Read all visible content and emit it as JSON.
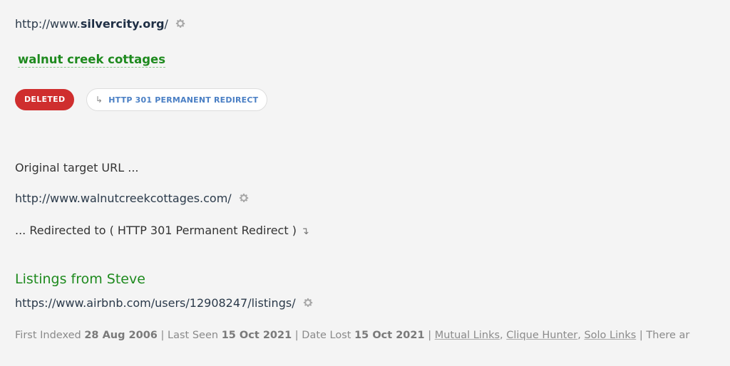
{
  "source": {
    "url_prefix": "http://www.",
    "url_domain": "silvercity.org",
    "url_suffix": "/",
    "settings_icon": "gear-icon"
  },
  "anchor_text": "walnut creek cottages",
  "badges": {
    "status": "DELETED",
    "status_color": "#cf2e2e",
    "redirect_arrow": "↳",
    "redirect": "HTTP 301 PERMANENT REDIRECT",
    "redirect_color": "#4a7fc4"
  },
  "redirect_info": {
    "original_label": "Original target URL ...",
    "original_url": "http://www.walnutcreekcottages.com/",
    "redirected_label": "... Redirected to ( HTTP 301 Permanent Redirect )",
    "redirected_icon": "↴"
  },
  "target": {
    "title": "Listings from Steve",
    "url": "https://www.airbnb.com/users/12908247/listings/"
  },
  "meta": {
    "first_indexed_label": "First Indexed",
    "first_indexed": "28 Aug 2006",
    "last_seen_label": "Last Seen",
    "last_seen": "15 Oct 2021",
    "date_lost_label": "Date Lost",
    "date_lost": "15 Oct 2021",
    "links": [
      "Mutual Links",
      "Clique Hunter",
      "Solo Links"
    ],
    "trailing": "There ar"
  },
  "colors": {
    "green": "#1e8a1e",
    "background": "#f4f4f4"
  }
}
